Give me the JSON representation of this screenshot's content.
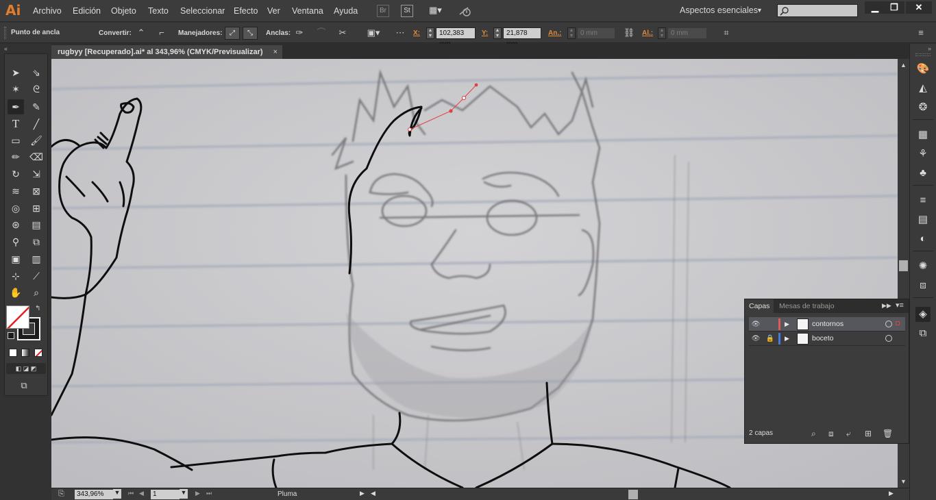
{
  "app": {
    "logo": "Ai"
  },
  "menu": [
    "Archivo",
    "Edición",
    "Objeto",
    "Texto",
    "Seleccionar",
    "Efecto",
    "Ver",
    "Ventana",
    "Ayuda"
  ],
  "menubar": {
    "bridge": "Br",
    "stock": "St",
    "workspace": "Aspectos esenciales",
    "search_placeholder": ""
  },
  "window": {
    "minimize": "▁",
    "restore": "❐",
    "close": "✕"
  },
  "control": {
    "anchor_label": "Punto de ancla",
    "convert_label": "Convertir:",
    "handles_label": "Manejadores:",
    "anchors_label": "Anclas:",
    "x_label": "X:",
    "x_value": "102,383 mm",
    "y_label": "Y:",
    "y_value": "21,878 mm",
    "w_label": "An.:",
    "w_value": "0 mm",
    "h_label": "Al.:",
    "h_value": "0 mm"
  },
  "document": {
    "tab_title": "rugbyy [Recuperado].ai* al 343,96% (CMYK/Previsualizar)",
    "close": "×"
  },
  "status": {
    "zoom": "343,96%",
    "page": "1",
    "tool": "Pluma"
  },
  "layers_panel": {
    "tabs": [
      "Capas",
      "Mesas de trabajo"
    ],
    "layers": [
      {
        "name": "contornos",
        "color": "#e05a5a",
        "visible": true,
        "locked": false,
        "selected": true
      },
      {
        "name": "boceto",
        "color": "#4a7ae0",
        "visible": true,
        "locked": true,
        "selected": false
      }
    ],
    "count": "2 capas"
  },
  "colors": {
    "accent": "#e27e2b",
    "selection": "#e04040",
    "canvas": "#c9c9cc"
  }
}
